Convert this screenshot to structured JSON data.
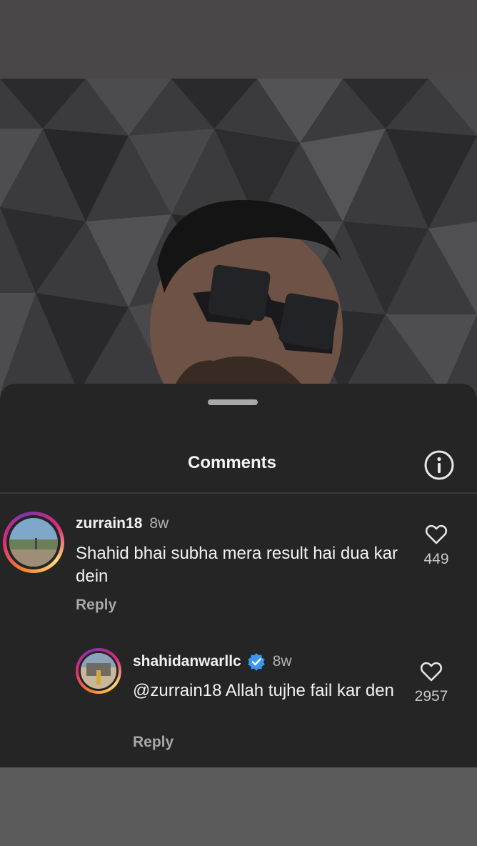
{
  "sheet": {
    "title": "Comments",
    "info_icon": "info-icon"
  },
  "comments": [
    {
      "username": "zurrain18",
      "time": "8w",
      "text": "Shahid bhai subha mera result hai dua kar dein",
      "reply_label": "Reply",
      "likes": "449",
      "verified": false
    },
    {
      "username": "shahidanwarllc",
      "time": "8w",
      "text": "@zurrain18 Allah tujhe fail kar den",
      "reply_label": "Reply",
      "likes": "2957",
      "verified": true
    }
  ],
  "colors": {
    "sheet_bg": "#252525",
    "verified_badge": "#3897f0"
  }
}
